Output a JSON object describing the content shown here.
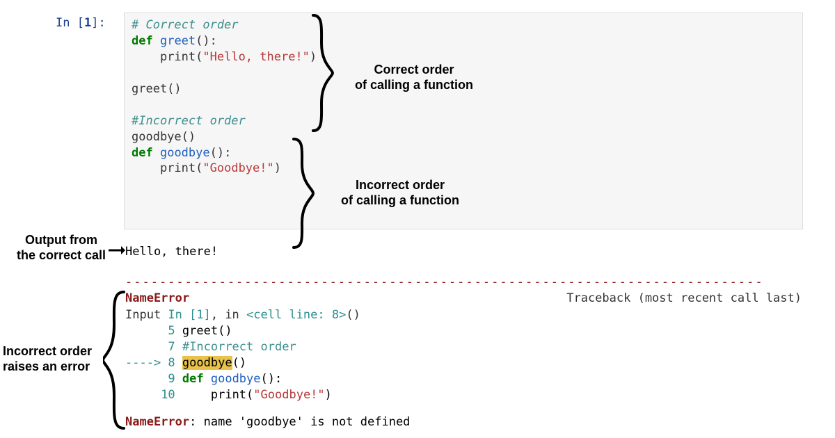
{
  "prompt": {
    "in_label": "In [",
    "num": "1",
    "close": "]:"
  },
  "code": {
    "l1_comment": "# Correct order",
    "l2_kw": "def",
    "l2_fn": "greet",
    "l2_paren": "():",
    "l3_fn": "print",
    "l3_open": "(",
    "l3_str": "\"Hello, there!\"",
    "l3_close": ")",
    "l5_call": "greet()",
    "l7_comment": "#Incorrect order",
    "l8_call": "goodbye()",
    "l9_kw": "def",
    "l9_fn": "goodbye",
    "l9_paren": "():",
    "l10_fn": "print",
    "l10_open": "(",
    "l10_str": "\"Goodbye!\"",
    "l10_close": ")"
  },
  "output_text": "Hello, there!",
  "dashes": "---------------------------------------------------------------------------",
  "error": {
    "name": "NameError",
    "traceback_label": "Traceback (most recent call last)",
    "input_prefix": "Input ",
    "in_label": "In [1]",
    "in_suffix": ", in ",
    "cell_ref": "<cell line: 8>",
    "cell_suffix": "()",
    "tb5_num": "5",
    "tb5_txt": " greet()",
    "tb7_num": "7",
    "tb7_txt": " #Incorrect order",
    "tb8_arrow": "----> ",
    "tb8_num": "8",
    "tb8_space": " ",
    "tb8_hl": "goodbye",
    "tb8_rest": "()",
    "tb9_num": "9",
    "tb9_kw": " def",
    "tb9_fn": " goodbye",
    "tb9_rest": "():",
    "tb10_num": "10",
    "tb10_pad": "     ",
    "tb10_fn": "print",
    "tb10_open": "(",
    "tb10_str": "\"Goodbye!\"",
    "tb10_close": ")",
    "final_name": "NameError",
    "final_colon": ": ",
    "final_msg": "name 'goodbye' is not defined"
  },
  "annotations": {
    "correct_order_l1": "Correct order",
    "correct_order_l2": "of calling a function",
    "incorrect_order_l1": "Incorrect order",
    "incorrect_order_l2": "of calling a function",
    "output_label_l1": "Output from",
    "output_label_l2": "the correct call",
    "error_label_l1": "Incorrect order",
    "error_label_l2": "raises an error"
  }
}
